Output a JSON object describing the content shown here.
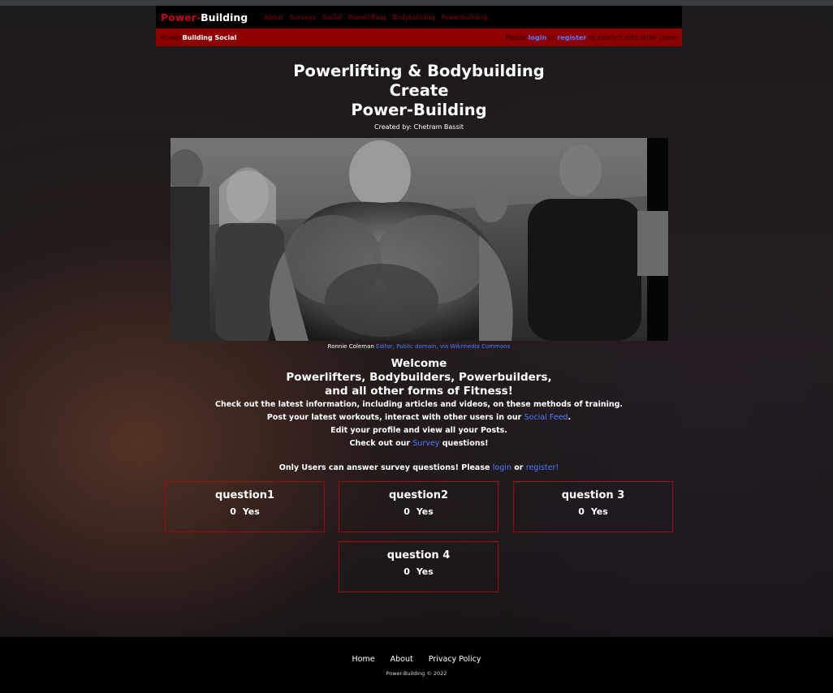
{
  "brand": {
    "part1": "Power-",
    "part2": "Building"
  },
  "nav": [
    "About",
    "Surveys",
    "Social",
    "Powerlifting",
    "Bodybuilding",
    "Powerbuilding"
  ],
  "subbar": {
    "left1": "Power-",
    "left2": "Building Social",
    "right_pre": "Please",
    "login": "login",
    "right_mid": "or",
    "register": "register",
    "right_post": "to interact with other users"
  },
  "hero": {
    "line1": "Powerlifting & Bodybuilding",
    "line2": "Create",
    "line3": "Power-Building",
    "created": "Created by: Chetram Bassit"
  },
  "caption": {
    "name": "Ronnie Coleman",
    "link": "Editor, Public domain, via Wikimedia Commons"
  },
  "welcome": {
    "h1": "Welcome",
    "h2": "Powerlifters, Bodybuilders, Powerbuilders,",
    "h3": "and all other forms of Fitness!",
    "p1": "Check out the latest information, including articles and videos, on these methods of training.",
    "p2_pre": "Post your latest workouts, interact with other users in our",
    "p2_link": "Social Feed",
    "p2_post": ".",
    "p3": "Edit your profile and view all your Posts.",
    "p4_pre": "Check out our",
    "p4_link": "Survey",
    "p4_post": "questions!"
  },
  "only": {
    "pre": "Only Users can answer survey questions! Please",
    "login": "login",
    "mid": "or",
    "register": "register!"
  },
  "questions": [
    {
      "title": "question1",
      "count": "0",
      "label": "Yes"
    },
    {
      "title": "question2",
      "count": "0",
      "label": "Yes"
    },
    {
      "title": "question 3",
      "count": "0",
      "label": "Yes"
    },
    {
      "title": "question 4",
      "count": "0",
      "label": "Yes"
    }
  ],
  "footer": {
    "links": [
      "Home",
      "About",
      "Privacy Policy"
    ],
    "copy": "Power-Building © 2022"
  },
  "colors": {
    "accent": "#8e0000",
    "link": "#4d7cff",
    "brand_red": "#c0001a"
  }
}
